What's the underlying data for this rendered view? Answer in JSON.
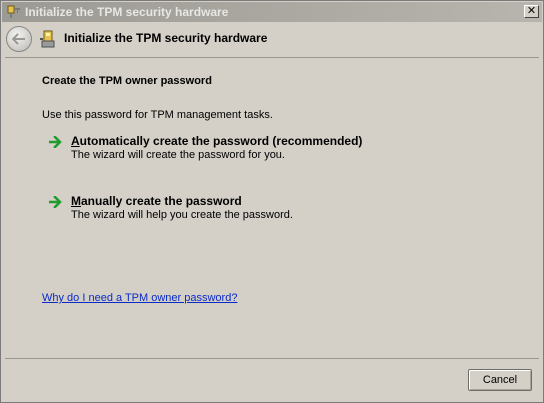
{
  "window": {
    "title": "Initialize the TPM security hardware",
    "close_glyph": "✕"
  },
  "header": {
    "title": "Initialize the TPM security hardware"
  },
  "main": {
    "section_title": "Create the TPM owner password",
    "intro": "Use this password for TPM management tasks.",
    "options": [
      {
        "accel": "A",
        "title_rest": "utomatically create the password (recommended)",
        "description": "The wizard will create the password for you."
      },
      {
        "accel": "M",
        "title_rest": "anually create the password",
        "description": "The wizard will help you create the password."
      }
    ],
    "help_link": "Why do I need a TPM owner password?"
  },
  "footer": {
    "cancel_label": "Cancel"
  },
  "colors": {
    "arrow": "#1e9c2c",
    "link": "#0a2ac8"
  }
}
